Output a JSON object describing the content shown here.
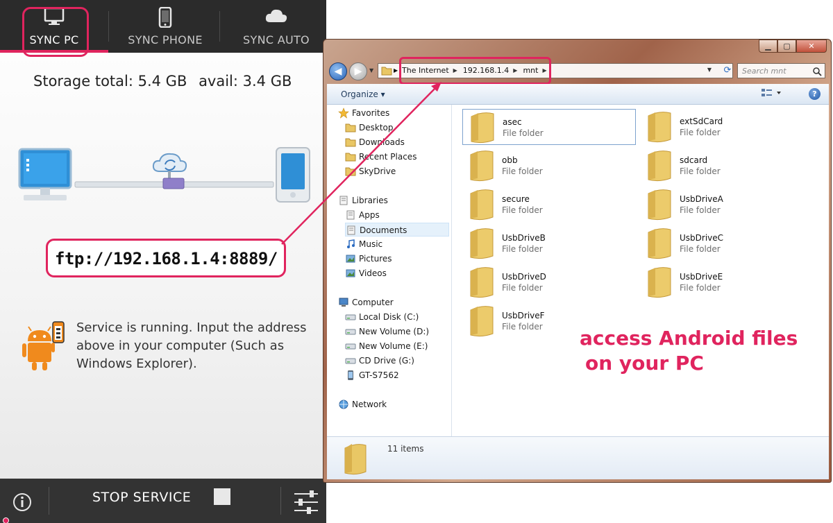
{
  "android": {
    "tabs": [
      {
        "label": "SYNC PC",
        "icon": "monitor-icon",
        "active": true
      },
      {
        "label": "SYNC PHONE",
        "icon": "phone-icon",
        "active": false
      },
      {
        "label": "SYNC AUTO",
        "icon": "cloud-icon",
        "active": false
      }
    ],
    "storage": {
      "total": "Storage total: 5.4 GB",
      "avail": "avail: 3.4 GB"
    },
    "ftp_address": "ftp://192.168.1.4:8889/",
    "service_message": "Service is running. Input the address above in your computer (Such as Windows Explorer).",
    "bottom": {
      "info_icon": "info-icon",
      "stop_label": "STOP SERVICE",
      "settings_icon": "sliders-icon"
    },
    "colors": {
      "accent": "#e0245e",
      "bar": "#2b2b2b",
      "android_green": "#f08a1d"
    }
  },
  "explorer": {
    "address": {
      "crumbs": [
        "The Internet",
        "192.168.1.4",
        "mnt"
      ]
    },
    "search_placeholder": "Search mnt",
    "command_bar": {
      "organize": "Organize ▾",
      "view_icon": "view-icon",
      "help_label": "?"
    },
    "nav_pane": [
      {
        "label": "Favorites",
        "icon": "star-icon",
        "level": 0
      },
      {
        "label": "Desktop",
        "icon": "desktop-icon",
        "level": 1
      },
      {
        "label": "Downloads",
        "icon": "downloads-icon",
        "level": 1
      },
      {
        "label": "Recent Places",
        "icon": "recent-places-icon",
        "level": 1
      },
      {
        "label": "SkyDrive",
        "icon": "skydrive-icon",
        "level": 1
      },
      {
        "label": "Libraries",
        "icon": "libraries-icon",
        "level": 0
      },
      {
        "label": "Apps",
        "icon": "apps-icon",
        "level": 1
      },
      {
        "label": "Documents",
        "icon": "documents-icon",
        "level": 1,
        "selected": true
      },
      {
        "label": "Music",
        "icon": "music-icon",
        "level": 1
      },
      {
        "label": "Pictures",
        "icon": "pictures-icon",
        "level": 1
      },
      {
        "label": "Videos",
        "icon": "videos-icon",
        "level": 1
      },
      {
        "label": "Computer",
        "icon": "computer-icon",
        "level": 0
      },
      {
        "label": "Local Disk (C:)",
        "icon": "disk-icon",
        "level": 1
      },
      {
        "label": "New Volume (D:)",
        "icon": "disk-icon",
        "level": 1
      },
      {
        "label": "New Volume (E:)",
        "icon": "disk-icon",
        "level": 1
      },
      {
        "label": "CD Drive (G:)",
        "icon": "cd-drive-icon",
        "level": 1
      },
      {
        "label": "GT-S7562",
        "icon": "device-icon",
        "level": 1
      },
      {
        "label": "Network",
        "icon": "network-icon",
        "level": 0
      }
    ],
    "folders": [
      {
        "name": "asec",
        "type": "File folder",
        "selected": true
      },
      {
        "name": "extSdCard",
        "type": "File folder"
      },
      {
        "name": "obb",
        "type": "File folder"
      },
      {
        "name": "sdcard",
        "type": "File folder"
      },
      {
        "name": "secure",
        "type": "File folder"
      },
      {
        "name": "UsbDriveA",
        "type": "File folder"
      },
      {
        "name": "UsbDriveB",
        "type": "File folder"
      },
      {
        "name": "UsbDriveC",
        "type": "File folder"
      },
      {
        "name": "UsbDriveD",
        "type": "File folder"
      },
      {
        "name": "UsbDriveE",
        "type": "File folder"
      },
      {
        "name": "UsbDriveF",
        "type": "File folder"
      }
    ],
    "status": {
      "item_count": "11 items"
    }
  },
  "annotation": {
    "line1": "access Android files",
    "line2": "on your PC"
  }
}
